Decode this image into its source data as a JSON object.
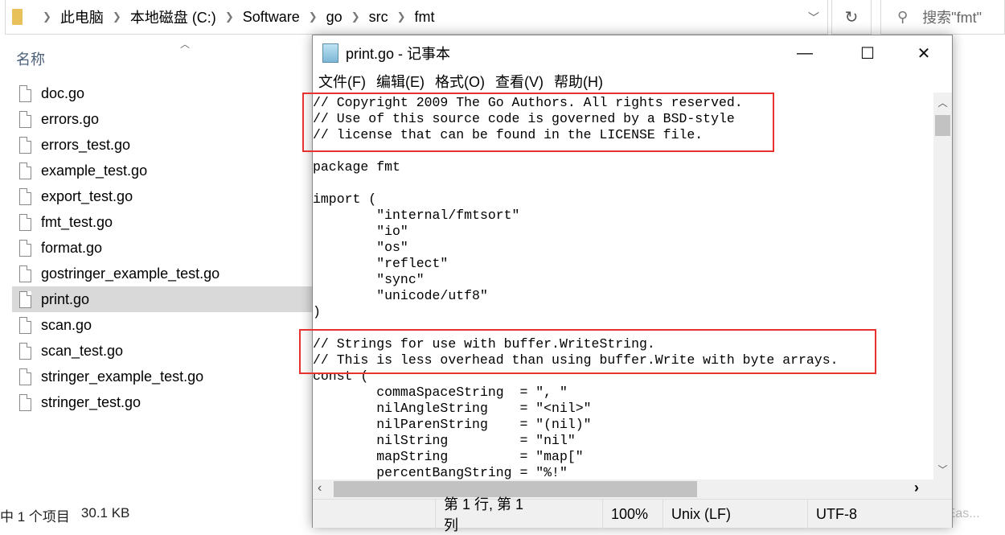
{
  "explorer": {
    "breadcrumb": [
      "此电脑",
      "本地磁盘 (C:)",
      "Software",
      "go",
      "src",
      "fmt"
    ],
    "search_placeholder": "搜索\"fmt\"",
    "column_name": "名称",
    "files": [
      "doc.go",
      "errors.go",
      "errors_test.go",
      "example_test.go",
      "export_test.go",
      "fmt_test.go",
      "format.go",
      "gostringer_example_test.go",
      "print.go",
      "scan.go",
      "scan_test.go",
      "stringer_example_test.go",
      "stringer_test.go"
    ],
    "selected_file": "print.go",
    "status_items": "中 1 个项目",
    "status_size": "30.1 KB"
  },
  "notepad": {
    "title": "print.go - 记事本",
    "menu": [
      "文件(F)",
      "编辑(E)",
      "格式(O)",
      "查看(V)",
      "帮助(H)"
    ],
    "lines": [
      "// Copyright 2009 The Go Authors. All rights reserved.",
      "// Use of this source code is governed by a BSD-style",
      "// license that can be found in the LICENSE file.",
      "",
      "package fmt",
      "",
      "import (",
      "\t\"internal/fmtsort\"",
      "\t\"io\"",
      "\t\"os\"",
      "\t\"reflect\"",
      "\t\"sync\"",
      "\t\"unicode/utf8\"",
      ")",
      "",
      "// Strings for use with buffer.WriteString.",
      "// This is less overhead than using buffer.Write with byte arrays.",
      "const (",
      "\tcommaSpaceString  = \", \"",
      "\tnilAngleString    = \"<nil>\"",
      "\tnilParenString    = \"(nil)\"",
      "\tnilString         = \"nil\"",
      "\tmapString         = \"map[\"",
      "\tpercentBangString = \"%!\""
    ],
    "status": {
      "position": "第 1 行, 第 1 列",
      "zoom": "100%",
      "line_ending": "Unix (LF)",
      "encoding": "UTF-8"
    }
  },
  "watermark": "https://blog.csdn.net/Eas..."
}
